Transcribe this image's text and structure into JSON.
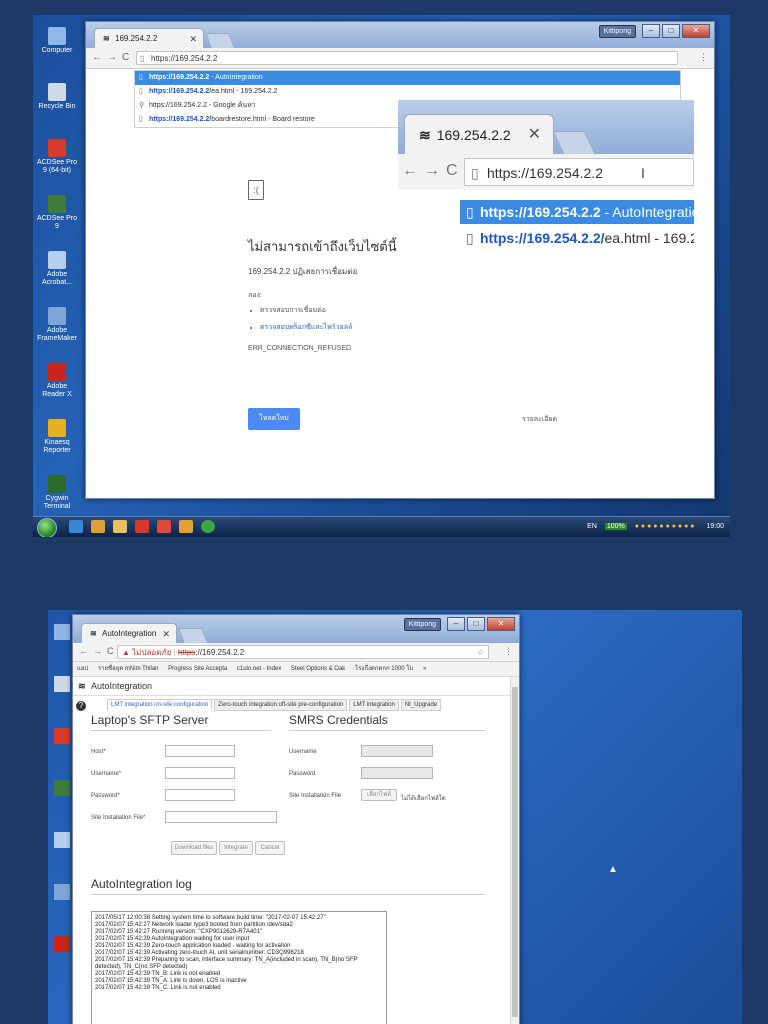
{
  "shot1": {
    "desktop_icons": [
      "Computer",
      "Recycle Bin",
      "ACDSee Pro 9 (64-bit)",
      "ACDSee Pro 9",
      "Adobe Acrobat...",
      "Adobe FrameMaker",
      "Adobe Reader X",
      "Kinaesq Reporter",
      "Cygwin Terminal"
    ],
    "browser": {
      "tab_title": "169.254.2.2",
      "user_label": "Kittipong",
      "url": "https://169.254.2.2",
      "suggestions": [
        {
          "bold": "https://169.254.2.2",
          "rest": " - AutoIntegration",
          "icon": "page"
        },
        {
          "bold": "https://169.254.2.2/",
          "rest": "ea.html - 169.254.2.2",
          "icon": "page"
        },
        {
          "bold": "",
          "rest": "https://169.254.2.2 - Google ค้นหา",
          "icon": "search"
        },
        {
          "bold": "https://169.254.2.2/",
          "rest": "boardrestore.html - Board restore",
          "icon": "page"
        }
      ],
      "error": {
        "title": "ไม่สามารถเข้าถึงเว็บไซต์นี้",
        "host_line": "169.254.2.2 ปฏิเสธการเชื่อมต่อ",
        "try_label": "ลอง:",
        "items": [
          "ตรวจสอบการเชื่อมต่อ",
          "ตรวจสอบพร็อกซีและไฟร์วอลล์"
        ],
        "code": "ERR_CONNECTION_REFUSED",
        "reload": "โหลดใหม่",
        "details": "รายละเอียด"
      }
    },
    "zoom": {
      "tab_title": "169.254.2.2",
      "url": "https://169.254.2.2",
      "item1_bold": "https://169.254.2.2",
      "item1_rest": " - AutoIntegration",
      "item2_bold": "https://169.254.2.2/",
      "item2_rest": "ea.html - 169.254.2.2"
    },
    "taskbar": {
      "lang": "EN",
      "battery": "100%",
      "time": "19:00"
    }
  },
  "shot2": {
    "browser": {
      "tab_title": "AutoIntegration",
      "user_label": "Kittipong",
      "security": "ไม่ปลอดภัย",
      "url_scheme": "https",
      "url_rest": "://169.254.2.2",
      "bookmarks": [
        "แอป",
        "รายชื่อยุค mNim Thilan",
        "Progress Site Accepta",
        "c1ulo.net - Index",
        "Steel Options & Oak",
        "โรงกึ่งตกตกก 1000 โบ",
        "»"
      ]
    },
    "app": {
      "header": "AutoIntegration",
      "tabs": [
        "LMT integration on-site configuration",
        "Zero-touch integration off-site pre-configuration",
        "LMT integration",
        "NI_Upgrade"
      ],
      "sftp": {
        "title": "Laptop's SFTP Server",
        "host": "Host",
        "username": "Username",
        "password": "Password",
        "site_file": "Site Installation File"
      },
      "smrs": {
        "title": "SMRS Credentials",
        "username": "Username",
        "password": "Password",
        "site_file": "Site Installation File",
        "choose_btn": "เลือกไฟล์",
        "no_file": "ไม่ได้เลือกไฟล์ใด"
      },
      "buttons": [
        "Download files",
        "Integrate",
        "Cancel"
      ],
      "log_title": "AutoIntegration log",
      "log": [
        "2017/05/17 12:00:38 Setting system time to software build time: \"2017-02-07 15:42:27\"",
        "2017/02/07 15:42:27 Network loader type3 booted from partition /dev/sda2",
        "2017/02/07 15:42:27 Running version: \"CXP9012629-R7A401\"",
        "2017/02/07 15:42:39 AutoIntegration waiting for user input",
        "2017/02/07 15:42:39 Zero-touch application loaded - waiting for activation",
        "2017/02/07 15:42:39 Activating zero-touch AI, unit serialnumber: CD3Q996218",
        "2017/02/07 15:42:39 Preparing to scan, interface summary: TN_A(included in scan), TN_B(no SFP",
        "detected), TN_C(no SFP detected)",
        "2017/02/07 15:42:39 TN_B: Link is not enabled",
        "2017/02/07 15:42:39 TN_A: Link is down, LOS is inactive",
        "2017/02/07 15:42:39 TN_C: Link is not enabled"
      ]
    }
  },
  "colors": {
    "accent": "#3b8be5",
    "desktop": "#1f5aa8",
    "page_bg": "#1d3a66"
  }
}
